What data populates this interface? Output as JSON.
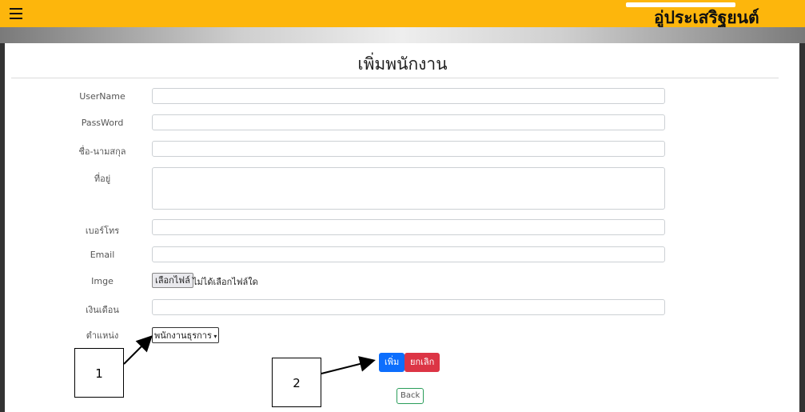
{
  "header": {
    "brand": "อู่ประเสริฐยนต์"
  },
  "page": {
    "title": "เพิ่มพนักงาน"
  },
  "form": {
    "username_label": "UserName",
    "password_label": "PassWord",
    "fullname_label": "ชื่อ-นามสกุล",
    "address_label": "ที่อยู่",
    "phone_label": "เบอร์โทร",
    "email_label": "Email",
    "image_label": "Imge",
    "file_button": "เลือกไฟล์",
    "file_status": "ไม่ได้เลือกไฟล์ใด",
    "salary_label": "เงินเดือน",
    "position_label": "ตำแหน่ง",
    "position_selected": "พนักงานธุรการ"
  },
  "actions": {
    "add": "เพิ่ม",
    "cancel": "ยกเลิก",
    "back": "Back"
  },
  "callouts": {
    "one": "1",
    "two": "2"
  }
}
